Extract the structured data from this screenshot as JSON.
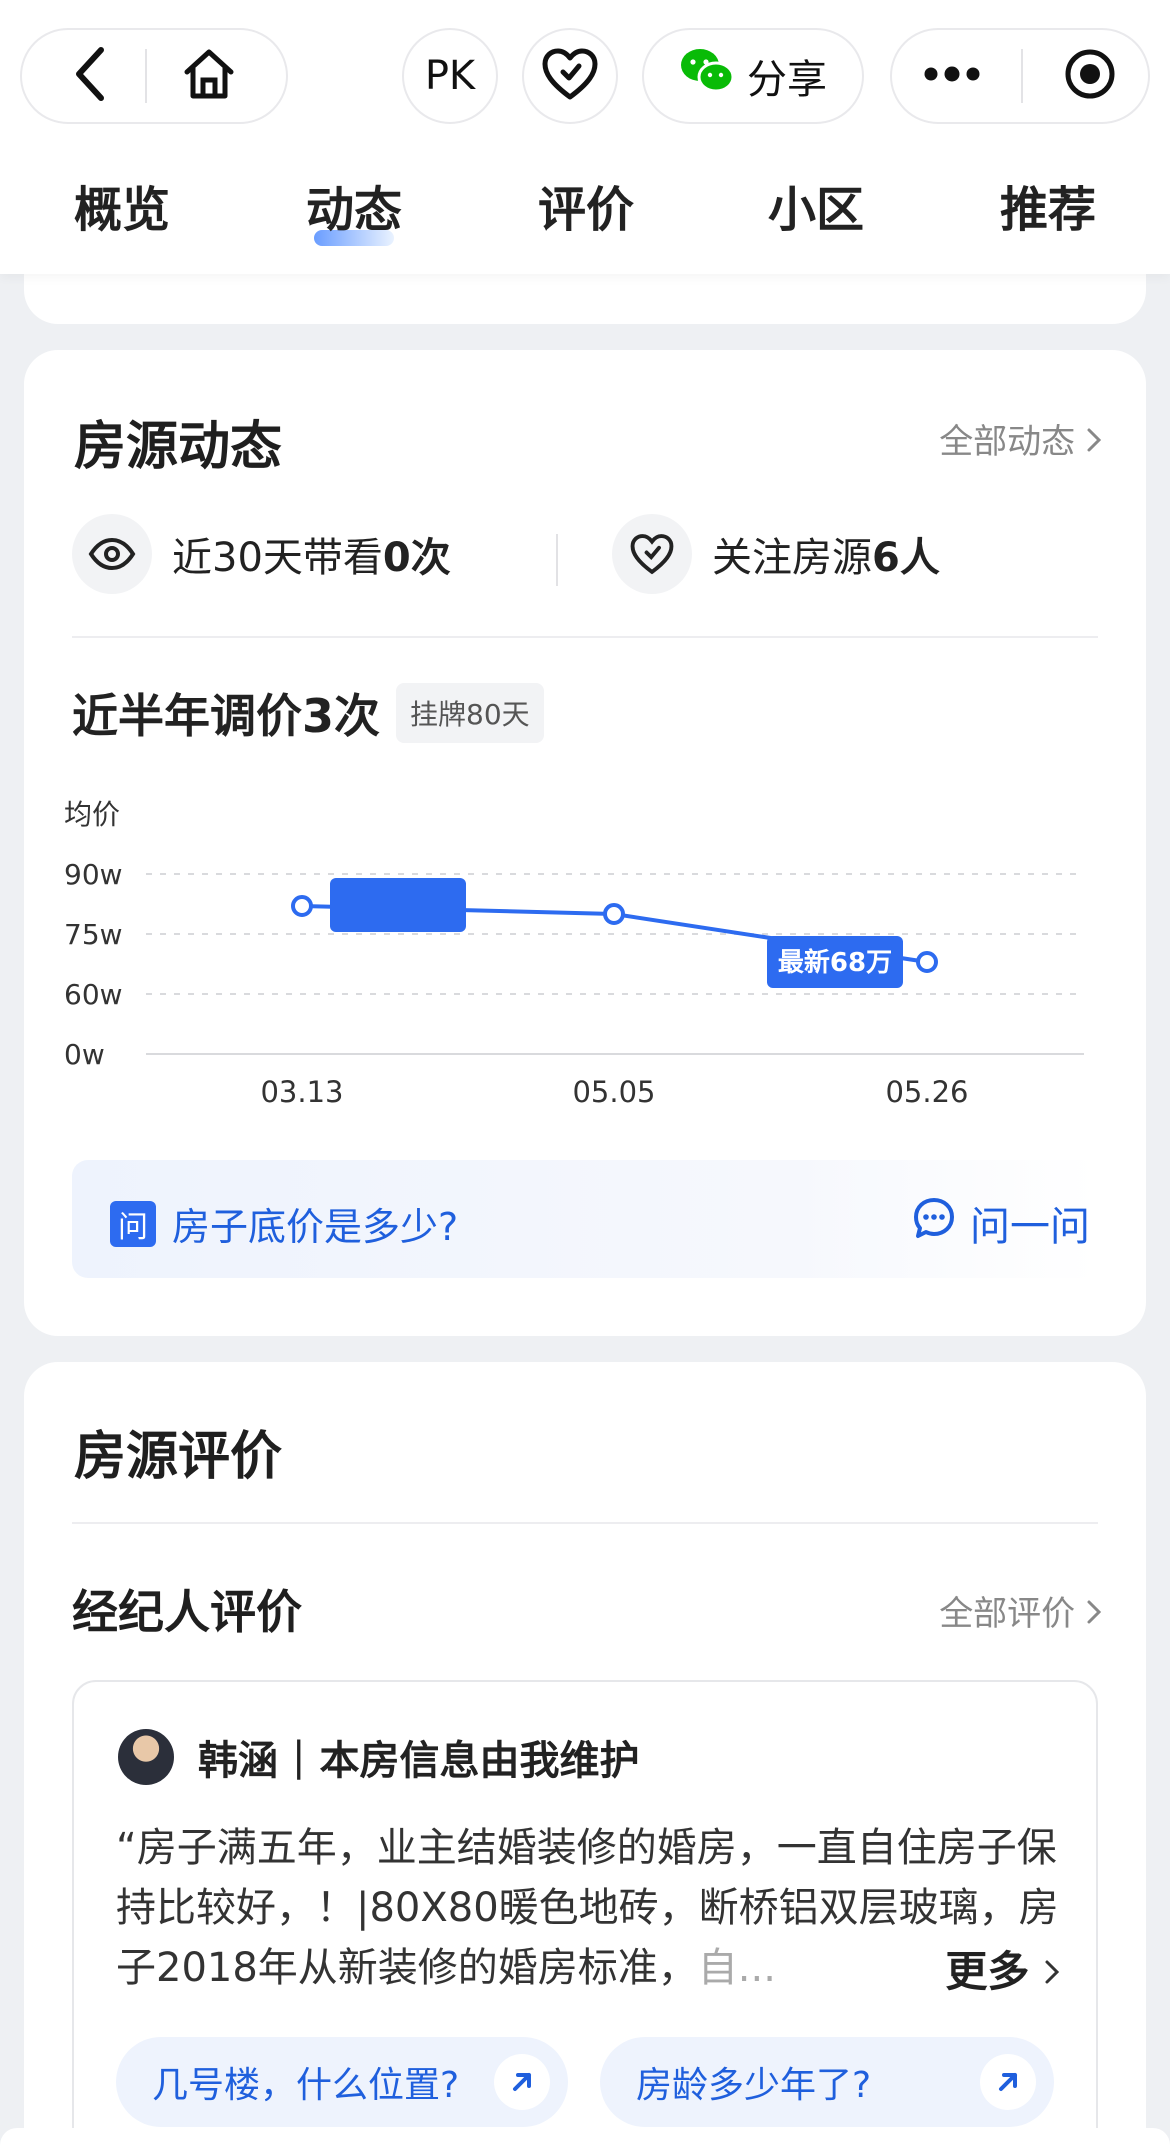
{
  "header": {
    "pk_label": "PK",
    "share_label": "分享",
    "tabs": [
      "概览",
      "动态",
      "评价",
      "小区",
      "推荐"
    ],
    "active_tab": "动态"
  },
  "dynamics": {
    "title": "房源动态",
    "all_link": "全部动态",
    "views_prefix": "近30天带看",
    "views_count": "0次",
    "follow_prefix": "关注房源",
    "follow_count": "6人",
    "price_title": "近半年调价3次",
    "listing_tag": "挂牌80天",
    "ask_question": "房子底价是多少?",
    "ask_badge": "问",
    "ask_button": "问一问"
  },
  "chart_data": {
    "type": "line",
    "ylabel": "均价",
    "y_ticks": [
      "90w",
      "75w",
      "60w",
      "0w"
    ],
    "x": [
      "03.13",
      "05.05",
      "05.26"
    ],
    "values": [
      82,
      80,
      68
    ],
    "latest_label": "最新68万",
    "colors": {
      "line": "#2d6bf0"
    }
  },
  "evaluation": {
    "title": "房源评价",
    "agent_section_title": "经纪人评价",
    "all_link": "全部评价",
    "agent_name": "韩涵",
    "agent_separator": "|",
    "agent_role": "本房信息由我维护",
    "quote_main": "“房子满五年，业主结婚装修的婚房，一直自住房子保持比较好，！|80X80暖色地砖，断桥铝双层玻璃，房子2018年从新装修的婚房标准，",
    "quote_fade": "自...",
    "more_label": "更多",
    "chips": [
      "几号楼，什么位置?",
      "房龄多少年了?"
    ]
  },
  "colors": {
    "accent": "#2d6bf0",
    "wechat": "#09bb07"
  }
}
